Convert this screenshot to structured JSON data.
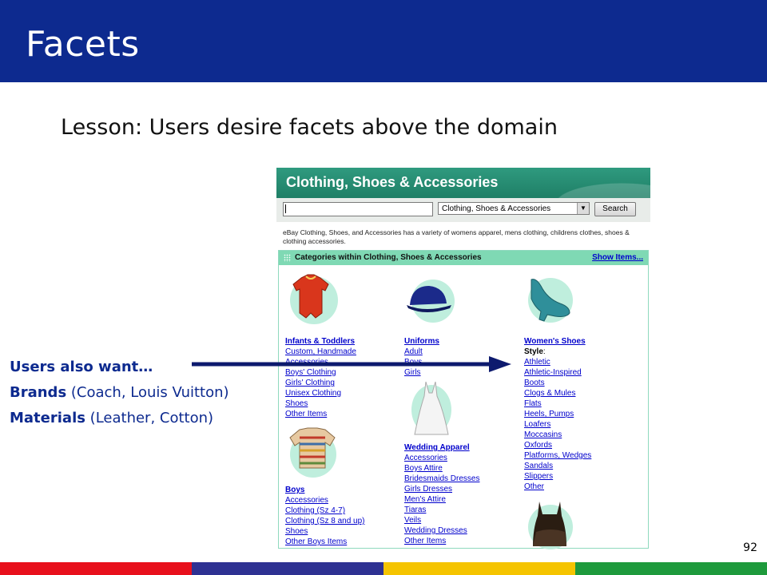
{
  "slide": {
    "title": "Facets",
    "lesson": "Lesson: Users desire facets above the domain",
    "page_number": "92",
    "footer_colors": [
      "#e8101c",
      "#2e3192",
      "#f5c400",
      "#1e9a3c"
    ],
    "accent": "#0d2a8f"
  },
  "callout": {
    "line1": "Users also want…",
    "brands_label": "Brands",
    "brands_rest": " (Coach, Louis Vuitton)",
    "materials_label": "Materials",
    "materials_rest": " (Leather, Cotton)"
  },
  "ebay": {
    "header_title": "Clothing, Shoes & Accessories",
    "search_input_value": "",
    "category_select": "Clothing, Shoes & Accessories",
    "search_button": "Search",
    "description": "eBay Clothing, Shoes, and Accessories has a variety of womens apparel, mens clothing, childrens clothes, shoes & clothing accessories.",
    "categories_bar_title": "Categories within Clothing, Shoes & Accessories",
    "show_items": "Show Items...",
    "infants": {
      "heading": "Infants & Toddlers",
      "items": [
        "Custom, Handmade",
        "Accessories",
        "Boys' Clothing",
        "Girls' Clothing",
        "Unisex Clothing",
        "Shoes",
        "Other Items"
      ]
    },
    "boys": {
      "heading": "Boys",
      "items": [
        "Accessories",
        "Clothing (Sz 4-7)",
        "Clothing (Sz 8 and up)",
        "Shoes",
        "Other Boys Items"
      ]
    },
    "uniforms": {
      "heading": "Uniforms",
      "items": [
        "Adult",
        "Boys",
        "Girls"
      ]
    },
    "wedding": {
      "heading": "Wedding Apparel",
      "items": [
        "Accessories",
        "Boys Attire",
        "Bridesmaids Dresses",
        "Girls Dresses",
        "Men's Attire",
        "Tiaras",
        "Veils",
        "Wedding Dresses",
        "Other Items"
      ]
    },
    "womens_shoes": {
      "heading": "Women's Shoes",
      "style_label": "Style",
      "style_colon": ":",
      "items": [
        "Athletic",
        "Athletic-Inspired",
        "Boots",
        "Clogs & Mules",
        "Flats",
        "Heels, Pumps",
        "Loafers",
        "Moccasins",
        "Oxfords",
        "Platforms, Wedges",
        "Sandals",
        "Slippers",
        "Other"
      ]
    }
  }
}
